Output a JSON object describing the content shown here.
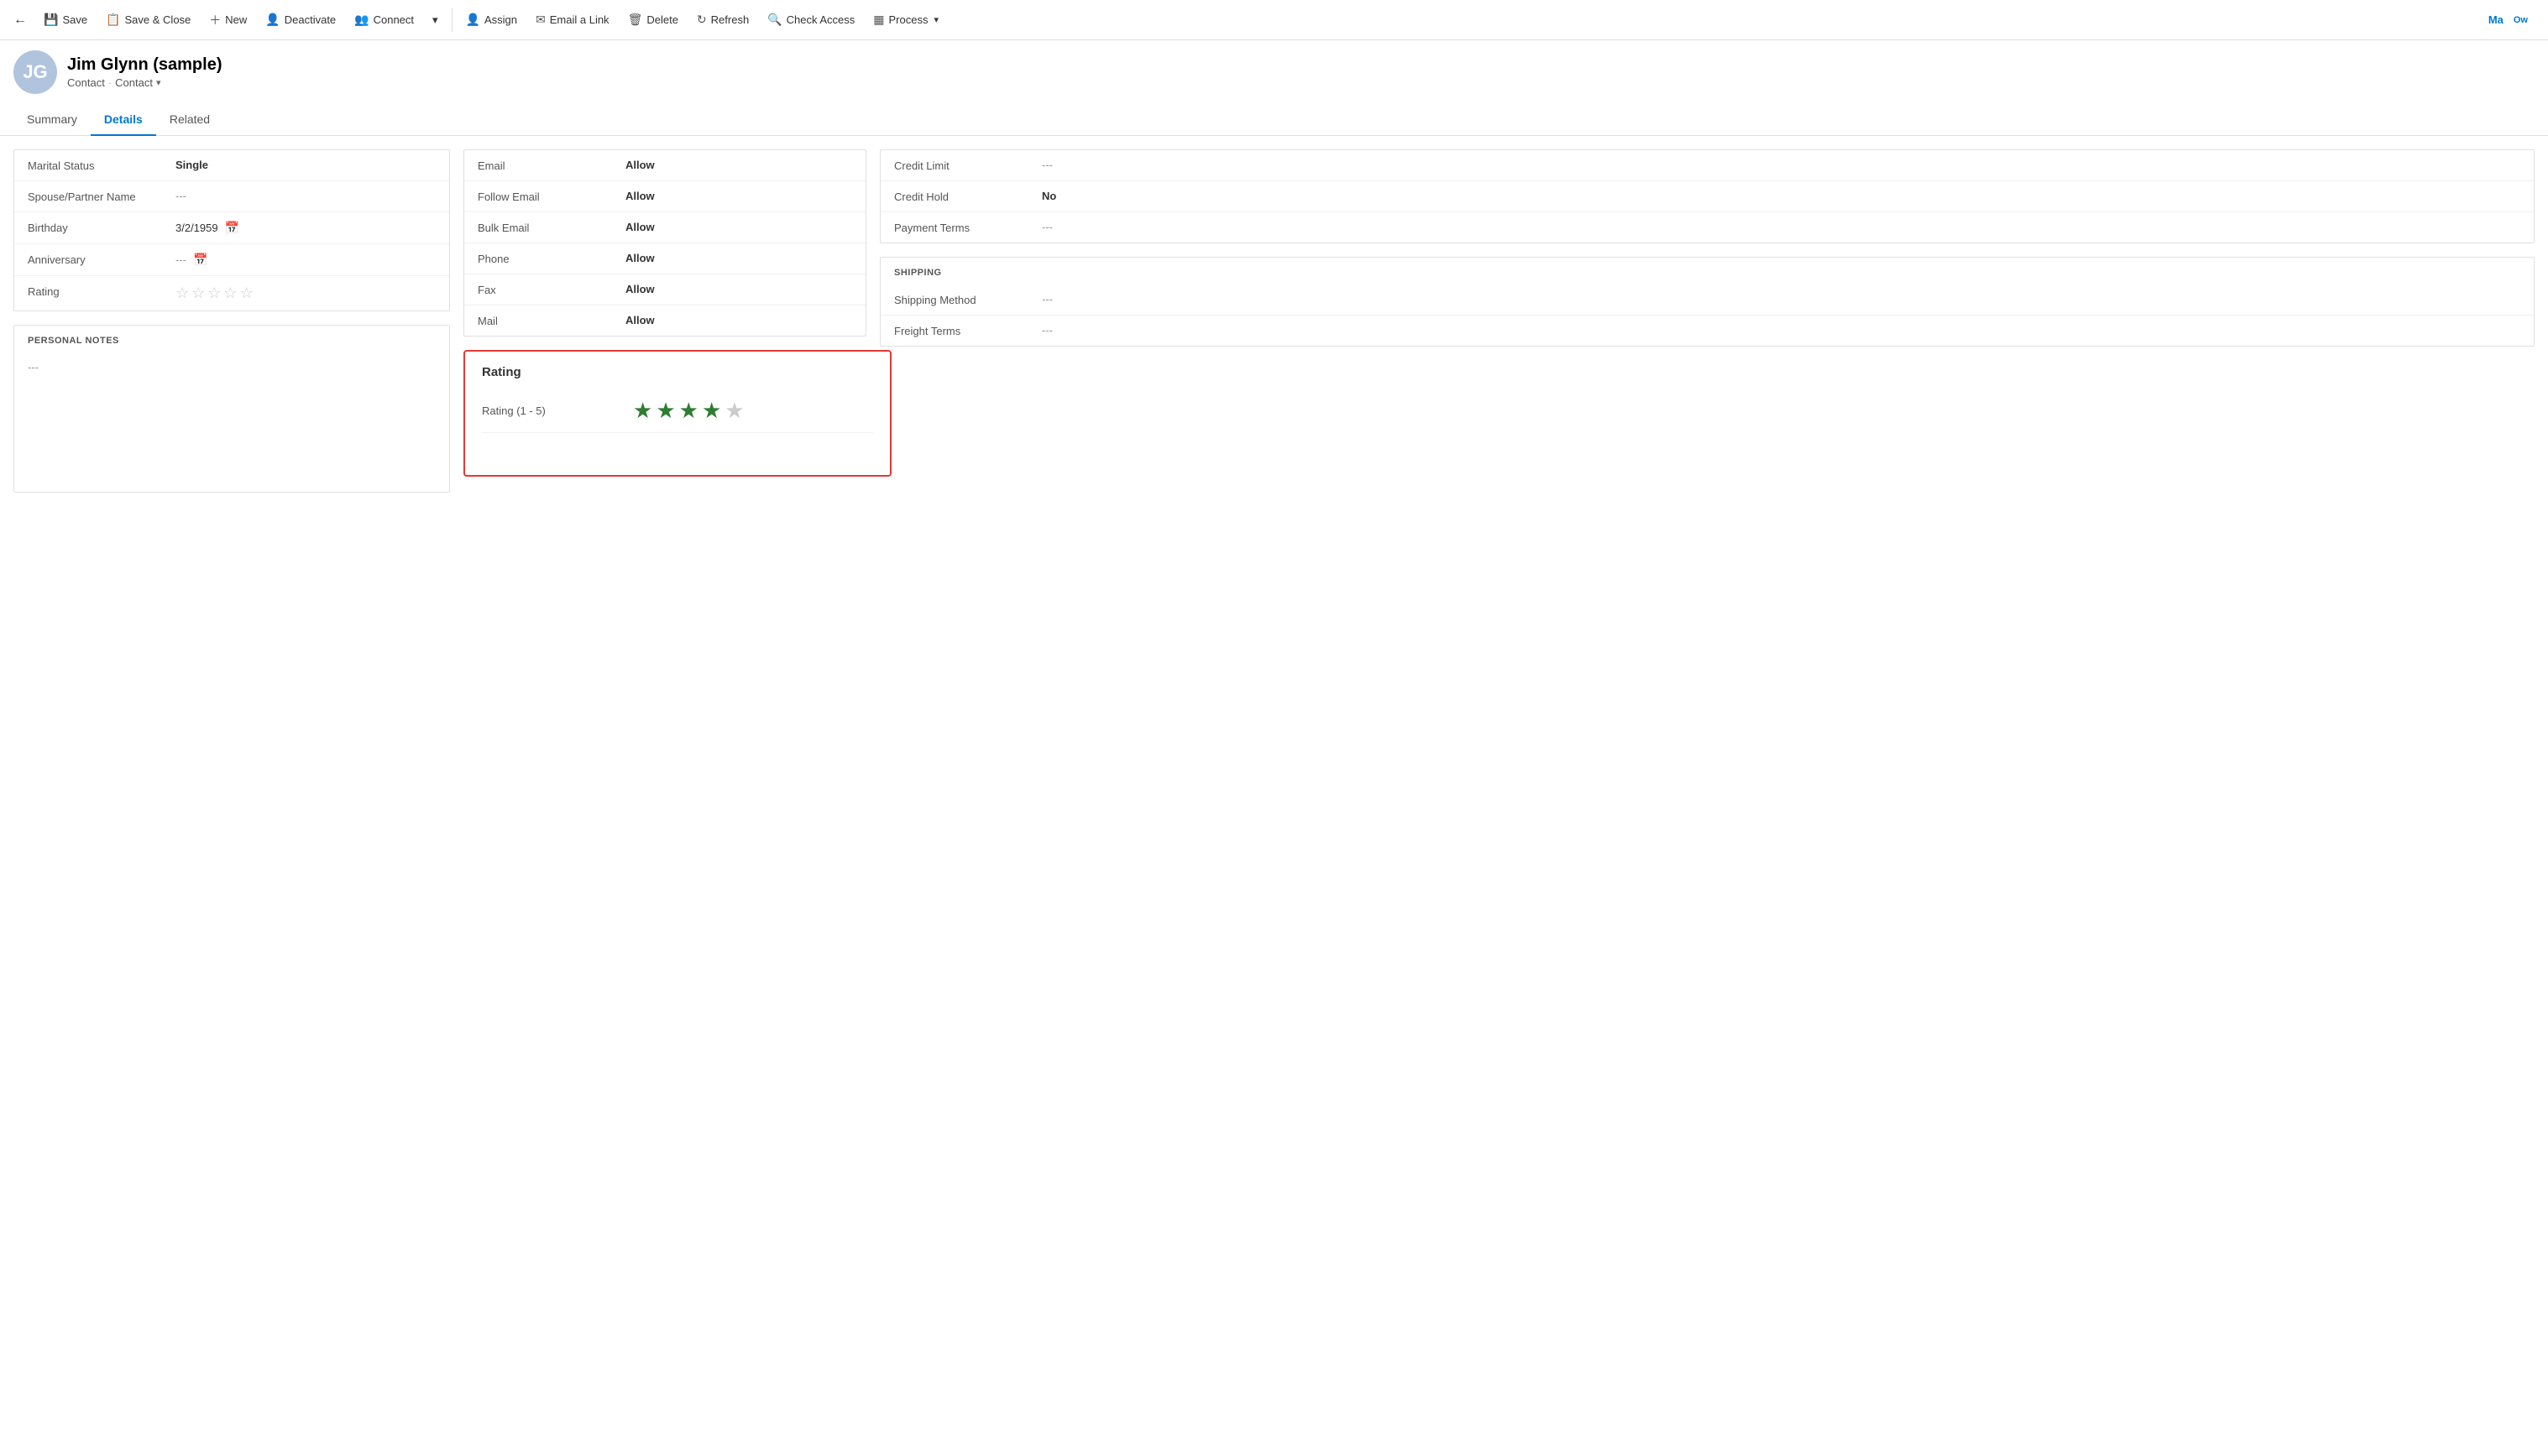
{
  "toolbar": {
    "back_label": "←",
    "save_label": "Save",
    "save_close_label": "Save & Close",
    "new_label": "New",
    "deactivate_label": "Deactivate",
    "connect_label": "Connect",
    "more_label": "▾",
    "assign_label": "Assign",
    "email_link_label": "Email a Link",
    "delete_label": "Delete",
    "refresh_label": "Refresh",
    "check_access_label": "Check Access",
    "process_label": "Process",
    "process_more_label": "▾"
  },
  "icons": {
    "save": "💾",
    "save_close": "📋",
    "new": "＋",
    "deactivate": "👤",
    "connect": "👥",
    "assign": "👤",
    "email": "✉",
    "delete": "🗑",
    "refresh": "↻",
    "check_access": "🔍",
    "process": "▦",
    "calendar": "📅",
    "back": "←"
  },
  "header": {
    "avatar_initials": "JG",
    "name": "Jim Glynn (sample)",
    "breadcrumb1": "Contact",
    "breadcrumb2": "Contact",
    "top_right_label": "Ma",
    "top_right_sub": "Ow"
  },
  "tabs": [
    {
      "label": "Summary",
      "active": false
    },
    {
      "label": "Details",
      "active": true
    },
    {
      "label": "Related",
      "active": false
    }
  ],
  "personal_section": {
    "fields": [
      {
        "label": "Marital Status",
        "value": "Single",
        "bold": true,
        "empty": false,
        "has_cal": false
      },
      {
        "label": "Spouse/Partner Name",
        "value": "---",
        "bold": false,
        "empty": true,
        "has_cal": false
      },
      {
        "label": "Birthday",
        "value": "3/2/1959",
        "bold": false,
        "empty": false,
        "has_cal": true
      },
      {
        "label": "Anniversary",
        "value": "---",
        "bold": false,
        "empty": true,
        "has_cal": true
      },
      {
        "label": "Rating",
        "value": "",
        "bold": false,
        "empty": false,
        "has_cal": false,
        "is_stars": true
      }
    ]
  },
  "personal_notes": {
    "section_title": "PERSONAL NOTES",
    "value": "---"
  },
  "contact_prefs": {
    "fields": [
      {
        "label": "Email",
        "value": "Allow",
        "bold": true
      },
      {
        "label": "Follow Email",
        "value": "Allow",
        "bold": true
      },
      {
        "label": "Bulk Email",
        "value": "Allow",
        "bold": true
      },
      {
        "label": "Phone",
        "value": "Allow",
        "bold": true
      },
      {
        "label": "Fax",
        "value": "Allow",
        "bold": true
      },
      {
        "label": "Mail",
        "value": "Allow",
        "bold": true
      }
    ]
  },
  "rating_popup": {
    "title": "Rating",
    "label": "Rating (1 - 5)",
    "filled_stars": 4,
    "total_stars": 5
  },
  "billing": {
    "section_title": "",
    "fields": [
      {
        "label": "Credit Limit",
        "value": "---",
        "bold": false,
        "empty": true
      },
      {
        "label": "Credit Hold",
        "value": "No",
        "bold": true,
        "empty": false
      },
      {
        "label": "Payment Terms",
        "value": "---",
        "bold": false,
        "empty": true
      }
    ]
  },
  "shipping": {
    "section_title": "SHIPPING",
    "fields": [
      {
        "label": "Shipping Method",
        "value": "---",
        "bold": false,
        "empty": true
      },
      {
        "label": "Freight Terms",
        "value": "---",
        "bold": false,
        "empty": true
      }
    ]
  }
}
